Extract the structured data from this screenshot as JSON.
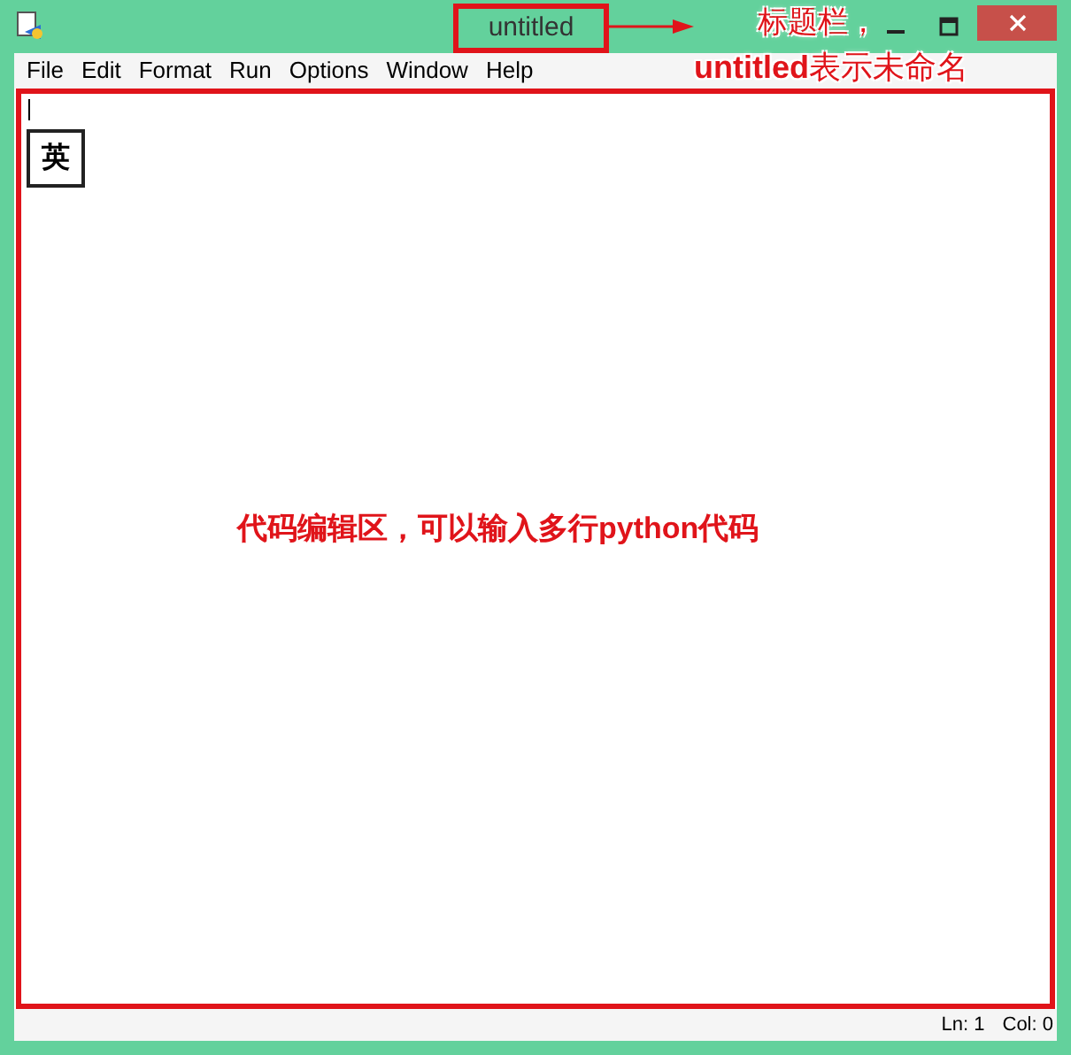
{
  "window": {
    "title": "untitled"
  },
  "menu": [
    "File",
    "Edit",
    "Format",
    "Run",
    "Options",
    "Window",
    "Help"
  ],
  "editor": {
    "ime_indicator": "英"
  },
  "status_bar": {
    "line": "Ln: 1",
    "column": "Col: 0"
  },
  "annotations": {
    "title_note": [
      "标题栏，",
      "**untitled**表示未命名"
    ],
    "editor_note": "代码编辑区，可以输入多行python代码"
  }
}
